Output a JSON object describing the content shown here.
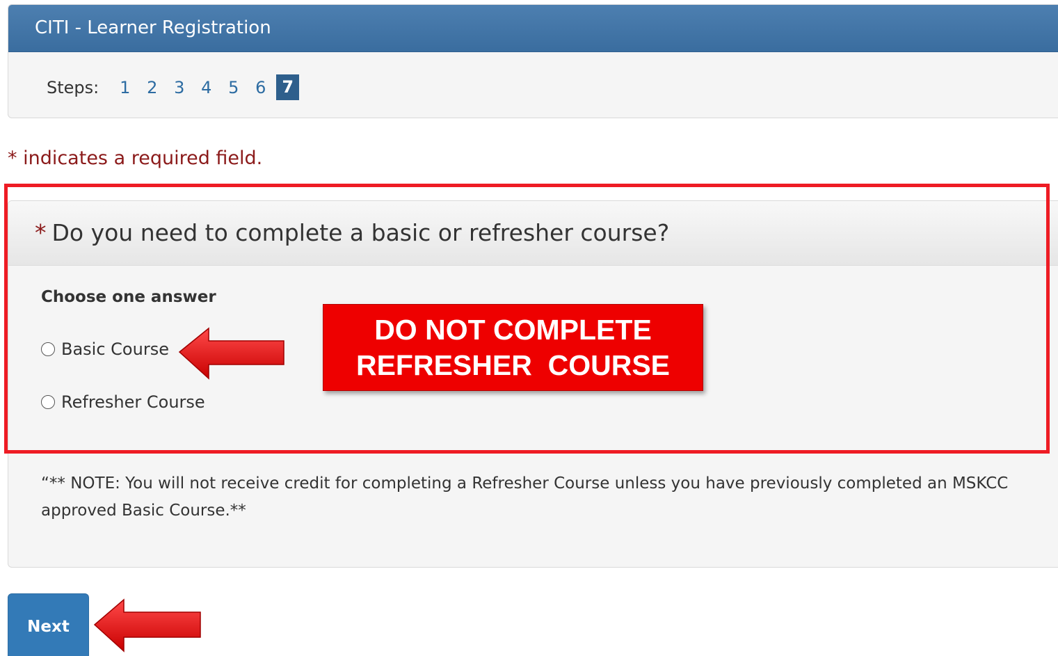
{
  "header": {
    "title": "CITI - Learner Registration",
    "steps_label": "Steps:",
    "steps": [
      "1",
      "2",
      "3",
      "4",
      "5",
      "6",
      "7"
    ],
    "current_step": "7"
  },
  "required_note": "* indicates a required field.",
  "question": {
    "required_marker": "*",
    "text": "Do you need to complete a basic or refresher course?",
    "choose_label": "Choose one answer",
    "options": [
      {
        "label": "Basic Course",
        "selected": false
      },
      {
        "label": "Refresher Course",
        "selected": false
      }
    ],
    "note": "“** NOTE: You will not receive credit for completing a Refresher Course unless you have previously completed an MSKCC approved Basic Course.**"
  },
  "callout": {
    "line1": "DO NOT COMPLETE",
    "line2": "REFRESHER  COURSE"
  },
  "next_button": {
    "label": "Next"
  },
  "colors": {
    "header_bar": "#3a6d9f",
    "current_step_bg": "#2e5f8c",
    "step_link": "#2d6ca2",
    "required_text": "#8b1a1a",
    "annotation_red": "#ee1c24",
    "callout_red": "#ee0000",
    "next_button": "#337ab7"
  }
}
